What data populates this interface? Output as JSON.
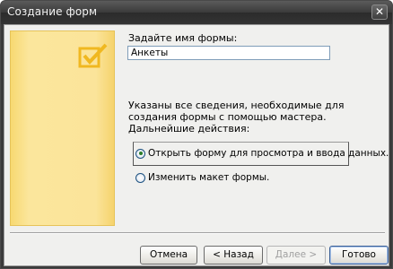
{
  "window": {
    "title": "Создание форм",
    "close_glyph": "✕"
  },
  "form": {
    "name_label": "Задайте имя формы:",
    "name_value": "Анкеты",
    "info_text": "Указаны все сведения, необходимые для создания формы с помощью мастера.",
    "next_actions_label": "Дальнейшие действия:",
    "options": [
      {
        "label": "Открыть форму для просмотра и ввода данных.",
        "checked": true
      },
      {
        "label": "Изменить макет формы.",
        "checked": false
      }
    ]
  },
  "buttons": {
    "cancel": "Отмена",
    "back": "< Назад",
    "next": "Далее >",
    "finish": "Готово"
  },
  "icons": {
    "wizard_image": "checkbox-checked-icon"
  },
  "colors": {
    "accent_yellow": "#f9dc7d",
    "titlebar": "#3a3a3a"
  }
}
